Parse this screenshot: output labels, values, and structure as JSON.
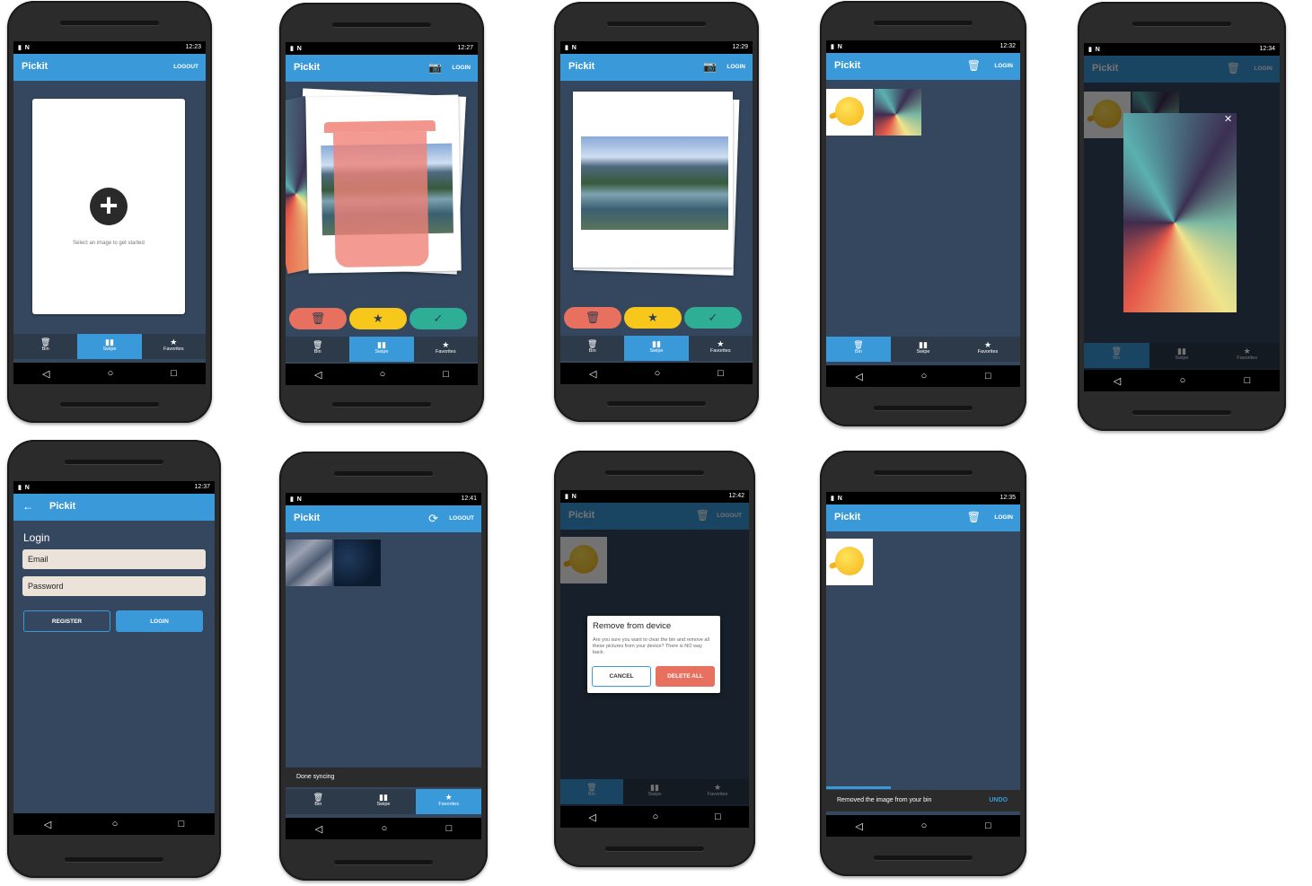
{
  "app": {
    "name": "Pickit"
  },
  "actions": {
    "logout": "LOGOUT",
    "login": "LOGIN"
  },
  "status_times": [
    "12:23",
    "12:27",
    "12:29",
    "12:32",
    "12:34",
    "12:37",
    "12:41",
    "12:42",
    "12:35"
  ],
  "bottom_nav": {
    "bin": "Bin",
    "swipe": "Swipe",
    "favorites": "Favorites"
  },
  "nav_glyphs": {
    "back": "◁",
    "home": "○",
    "recents": "□"
  },
  "icons": {
    "add": "+",
    "trash": "🗑",
    "star": "★",
    "check": "✓",
    "camera": "📷",
    "sync": "⟳",
    "delete_bin": "🗑",
    "close": "✕",
    "back_arrow": "←"
  },
  "screen1": {
    "hint": "Select an image to get started"
  },
  "screen6": {
    "heading": "Login",
    "email_placeholder": "Email",
    "password_placeholder": "Password",
    "register": "REGISTER",
    "login": "LOGIN"
  },
  "screen7": {
    "snackbar": "Done syncing"
  },
  "screen8": {
    "dialog_title": "Remove from device",
    "dialog_body": "Are you sure you want to clear the bin and remove all these pictures from your device? There is NO way back.",
    "cancel": "CANCEL",
    "delete_all": "DELETE ALL"
  },
  "screen9": {
    "snackbar": "Removed the image from your bin",
    "undo": "UNDO"
  },
  "colors": {
    "appbar": "#3a9ad9",
    "background": "#34475e",
    "delete": "#e8705f",
    "favorite": "#f7c71c",
    "keep": "#2eaf95",
    "phone": "#2b2b2b"
  }
}
